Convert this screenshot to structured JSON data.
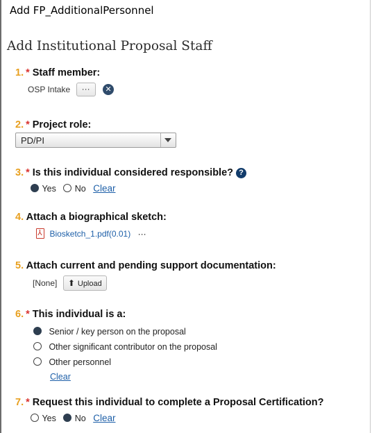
{
  "window": {
    "title": "Add FP_AdditionalPersonnel"
  },
  "page": {
    "heading": "Add Institutional Proposal Staff"
  },
  "questions": [
    {
      "num": "1.",
      "required": "*",
      "label": "Staff member:",
      "value": "OSP Intake",
      "ellipsis": "···",
      "clear_icon": "x-circle-icon"
    },
    {
      "num": "2.",
      "required": "*",
      "label": "Project role:",
      "selected": "PD/PI"
    },
    {
      "num": "3.",
      "required": "*",
      "label": "Is this individual considered responsible?",
      "help": "?",
      "options": [
        {
          "label": "Yes",
          "checked": true
        },
        {
          "label": "No",
          "checked": false
        }
      ],
      "clear": "Clear"
    },
    {
      "num": "4.",
      "label": "Attach a biographical sketch:",
      "file": "Biosketch_1.pdf(0.01)",
      "ellipsis": "···"
    },
    {
      "num": "5.",
      "label": "Attach current and pending support documentation:",
      "value": "[None]",
      "upload": "Upload"
    },
    {
      "num": "6.",
      "required": "*",
      "label": "This individual is a:",
      "options": [
        {
          "label": "Senior / key person on the proposal",
          "checked": true
        },
        {
          "label": "Other significant contributor on the proposal",
          "checked": false
        },
        {
          "label": "Other personnel",
          "checked": false
        }
      ],
      "clear": "Clear"
    },
    {
      "num": "7.",
      "required": "*",
      "label": "Request this individual to complete a Proposal Certification?",
      "options": [
        {
          "label": "Yes",
          "checked": false
        },
        {
          "label": "No",
          "checked": true
        }
      ],
      "clear": "Clear"
    }
  ],
  "colors": {
    "number": "#e8a020",
    "required": "#d9322f",
    "link": "#1d5fa8",
    "radio_selected": "#2e3e50"
  }
}
